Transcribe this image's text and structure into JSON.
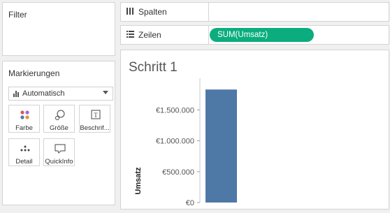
{
  "filters": {
    "title": "Filter"
  },
  "marks": {
    "title": "Markierungen",
    "type_selector": "Automatisch",
    "cards": [
      {
        "label": "Farbe",
        "icon": "color-dots-icon"
      },
      {
        "label": "Größe",
        "icon": "size-circles-icon"
      },
      {
        "label": "Beschrif...",
        "icon": "text-label-icon"
      },
      {
        "label": "Detail",
        "icon": "detail-dots-icon"
      },
      {
        "label": "QuickInfo",
        "icon": "tooltip-bubble-icon"
      }
    ]
  },
  "shelves": {
    "columns": {
      "label": "Spalten",
      "icon": "columns-icon",
      "pills": []
    },
    "rows": {
      "label": "Zeilen",
      "icon": "rows-icon",
      "pills": [
        "SUM(Umsatz)"
      ]
    },
    "pill_color": "#0bad7e"
  },
  "viz": {
    "title": "Schritt 1"
  },
  "chart_data": {
    "type": "bar",
    "title": "Schritt 1",
    "ylabel": "Umsatz",
    "categories": [
      ""
    ],
    "values": [
      1830000
    ],
    "ylim": [
      0,
      1900000
    ],
    "yticks": [
      0,
      500000,
      1000000,
      1500000
    ],
    "ytick_labels": [
      "€0",
      "€500.000",
      "€1.000.000",
      "€1.500.000"
    ],
    "bar_color": "#4e79a7",
    "grid": false
  }
}
